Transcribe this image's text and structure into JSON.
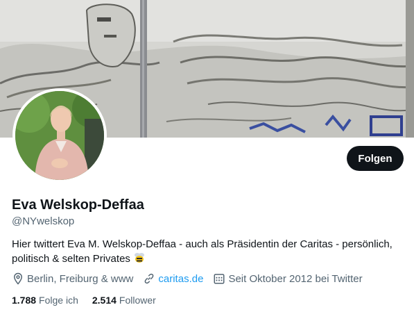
{
  "profile": {
    "name": "Eva Welskop-Deffaa",
    "handle": "@NYwelskop",
    "bio": "Hier twittert Eva M. Welskop-Deffaa - auch als Präsidentin der Caritas - persönlich, politisch & selten Privates",
    "bio_emoji_icon": "bee-icon",
    "location": "Berlin, Freiburg & www",
    "website": "caritas.de",
    "joined": "Seit Oktober 2012 bei Twitter"
  },
  "actions": {
    "follow_label": "Folgen"
  },
  "stats": {
    "following_count": "1.788",
    "following_label": "Folge ich",
    "followers_count": "2.514",
    "followers_label": "Follower"
  },
  "icons": {
    "location": "location-pin-icon",
    "website": "link-icon",
    "joined": "calendar-icon"
  },
  "colors": {
    "accent": "#1d9bf0",
    "button": "#0f1419",
    "secondary_text": "#536471"
  }
}
